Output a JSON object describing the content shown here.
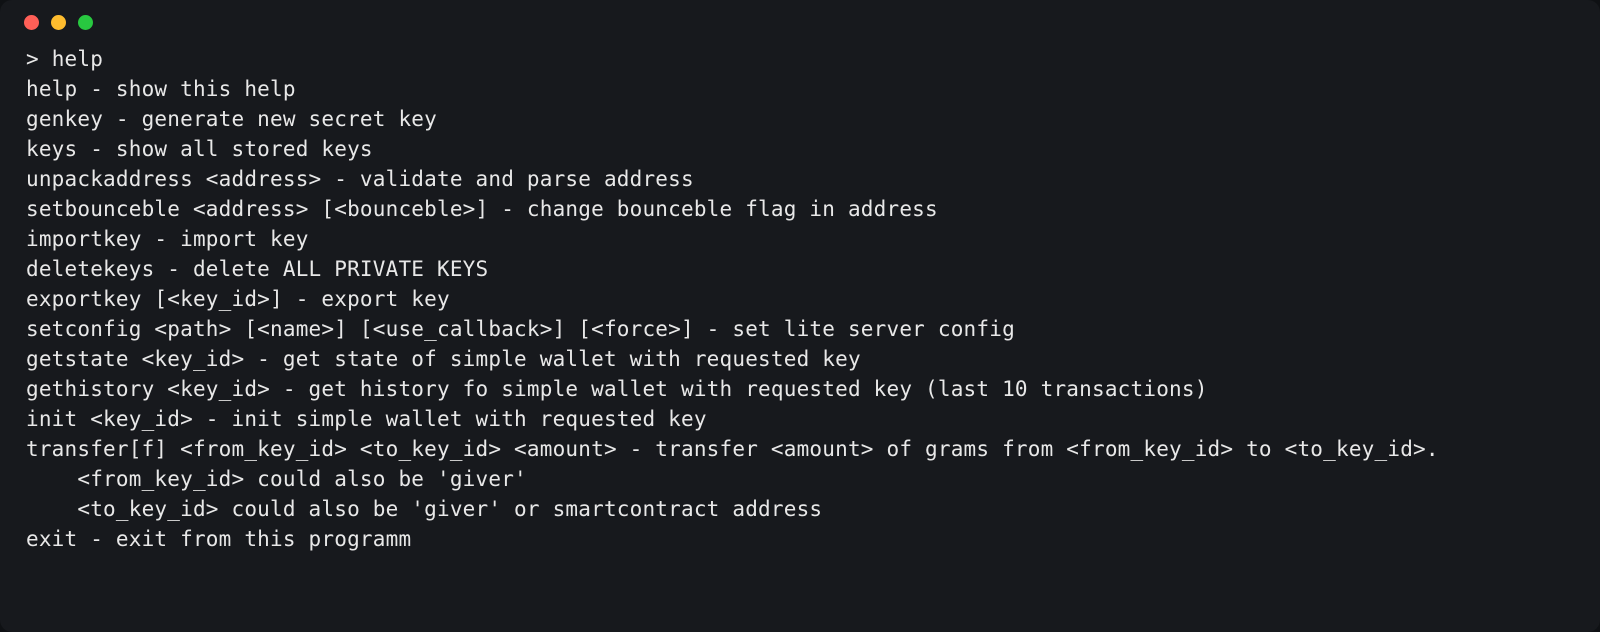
{
  "terminal": {
    "prompt": "> ",
    "command": "help",
    "lines": [
      "help - show this help",
      "genkey - generate new secret key",
      "keys - show all stored keys",
      "unpackaddress <address> - validate and parse address",
      "setbounceble <address> [<bounceble>] - change bounceble flag in address",
      "importkey - import key",
      "deletekeys - delete ALL PRIVATE KEYS",
      "exportkey [<key_id>] - export key",
      "setconfig <path> [<name>] [<use_callback>] [<force>] - set lite server config",
      "getstate <key_id> - get state of simple wallet with requested key",
      "gethistory <key_id> - get history fo simple wallet with requested key (last 10 transactions)",
      "init <key_id> - init simple wallet with requested key",
      "transfer[f] <from_key_id> <to_key_id> <amount> - transfer <amount> of grams from <from_key_id> to <to_key_id>.",
      "    <from_key_id> could also be 'giver'",
      "    <to_key_id> could also be 'giver' or smartcontract address",
      "exit - exit from this programm"
    ]
  }
}
